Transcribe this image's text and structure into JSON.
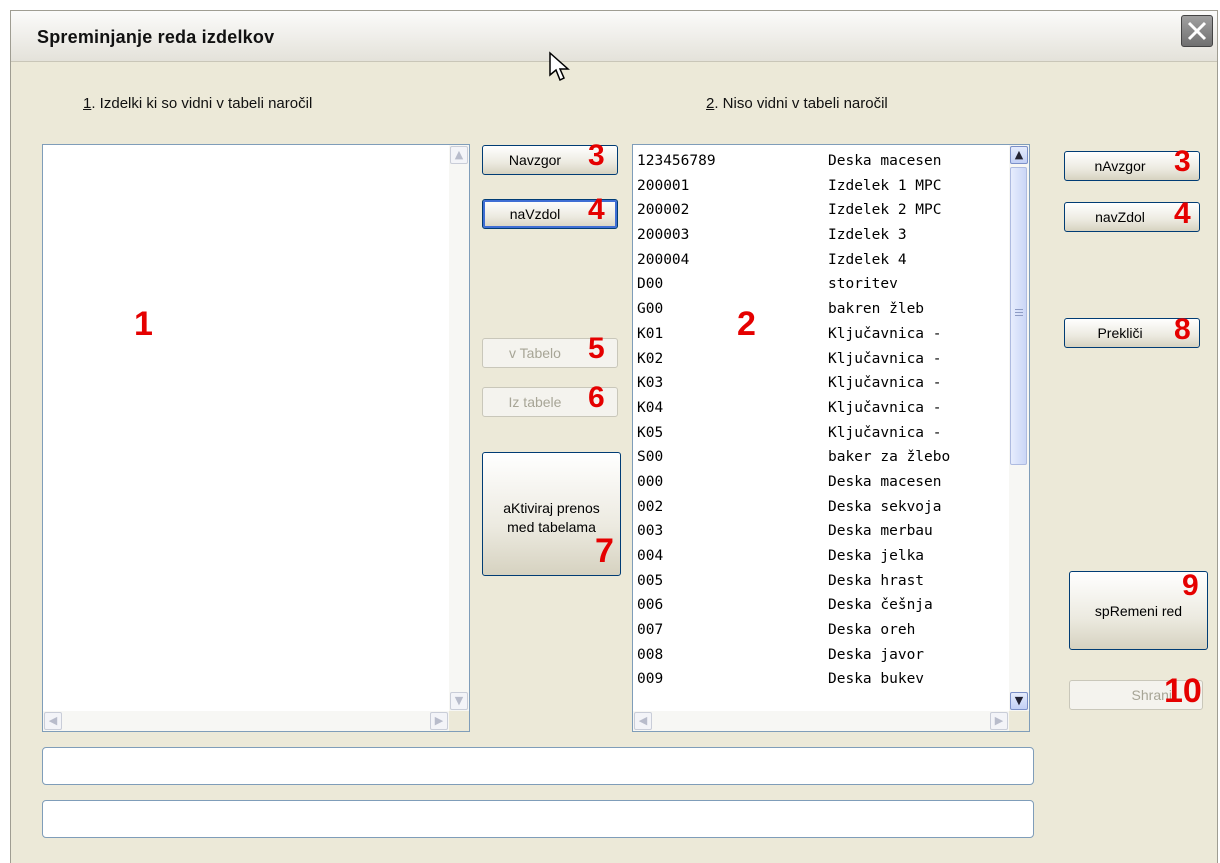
{
  "window": {
    "title": "Spreminjanje reda izdelkov",
    "close_glyph": "✕"
  },
  "labels": {
    "left_num": "1",
    "left_text": ". Izdelki ki so vidni v tabeli naročil",
    "right_num": "2",
    "right_text": ". Niso vidni v tabeli naročil"
  },
  "list_right": [
    {
      "code": "123456789",
      "name": "Deska macesen"
    },
    {
      "code": "200001",
      "name": "Izdelek 1 MPC"
    },
    {
      "code": "200002",
      "name": "Izdelek 2 MPC"
    },
    {
      "code": "200003",
      "name": "Izdelek 3"
    },
    {
      "code": "200004",
      "name": "Izdelek 4"
    },
    {
      "code": "D00",
      "name": "storitev"
    },
    {
      "code": "G00",
      "name": "bakren žleb"
    },
    {
      "code": "K01",
      "name": "Ključavnica -"
    },
    {
      "code": "K02",
      "name": "Ključavnica -"
    },
    {
      "code": "K03",
      "name": "Ključavnica -"
    },
    {
      "code": "K04",
      "name": "Ključavnica -"
    },
    {
      "code": "K05",
      "name": "Ključavnica -"
    },
    {
      "code": "S00",
      "name": "baker za žlebo"
    },
    {
      "code": "000",
      "name": "Deska macesen"
    },
    {
      "code": "002",
      "name": "Deska sekvoja"
    },
    {
      "code": "003",
      "name": "Deska merbau"
    },
    {
      "code": "004",
      "name": "Deska jelka"
    },
    {
      "code": "005",
      "name": "Deska hrast"
    },
    {
      "code": "006",
      "name": "Deska češnja"
    },
    {
      "code": "007",
      "name": "Deska oreh"
    },
    {
      "code": "008",
      "name": "Deska javor"
    },
    {
      "code": "009",
      "name": "Deska bukev"
    }
  ],
  "buttons": {
    "navzgor_left": "Navzgor",
    "navzdol_left": "naVzdol",
    "v_tabelo": "v Tabelo",
    "iz_tabele": "Iz tabele",
    "aktiviraj_line1": "aKtiviraj prenos",
    "aktiviraj_line2": "med tabelama",
    "navzgor_right": "nAvzgor",
    "navzdol_right": "navZdol",
    "preklici": "Prekliči",
    "spremeni": "spRemeni red",
    "shrani": "Shrani"
  },
  "annotations": {
    "n1": "1",
    "n2": "2",
    "n3a": "3",
    "n3b": "3",
    "n4a": "4",
    "n4b": "4",
    "n5": "5",
    "n6": "6",
    "n7": "7",
    "n8": "8",
    "n9": "9",
    "n10": "10"
  },
  "scroll": {
    "up": "▲",
    "down": "▼",
    "left": "◀",
    "right": "▶",
    "grip": "≡"
  },
  "colors": {
    "annotation": "#e50000",
    "window_bg": "#ece9d8",
    "list_border": "#7f9db9"
  }
}
